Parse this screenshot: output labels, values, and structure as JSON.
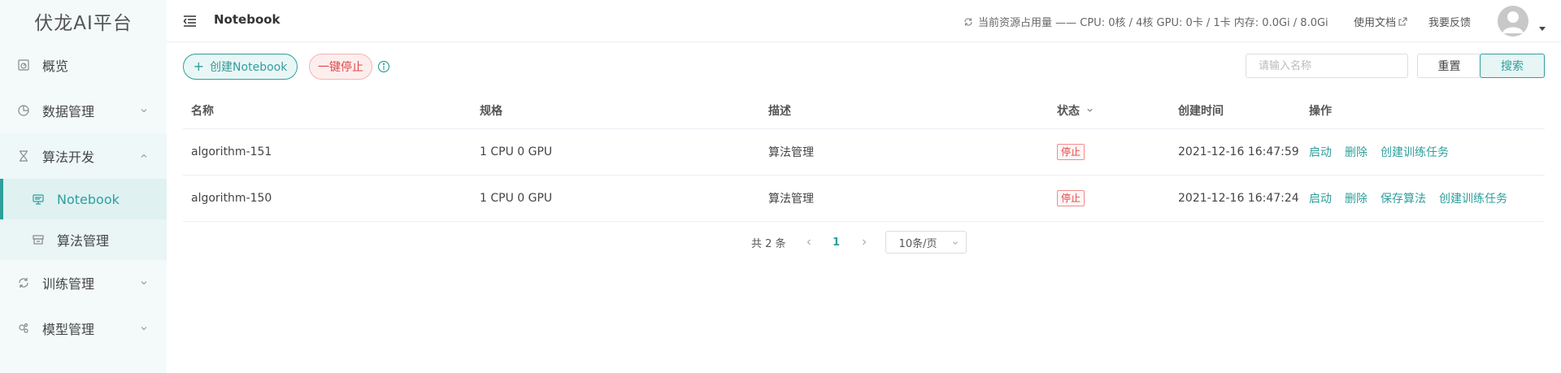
{
  "app": {
    "title": "伏龙AI平台"
  },
  "sidebar": {
    "items": [
      {
        "label": "概览",
        "icon": "dashboard-icon"
      },
      {
        "label": "数据管理",
        "icon": "pie-chart-icon"
      },
      {
        "label": "算法开发",
        "icon": "hourglass-icon"
      },
      {
        "label": "Notebook",
        "icon": "monitor-icon",
        "active": true
      },
      {
        "label": "算法管理",
        "icon": "archive-icon"
      },
      {
        "label": "训练管理",
        "icon": "cycle-icon"
      },
      {
        "label": "模型管理",
        "icon": "cog-cluster-icon"
      }
    ]
  },
  "header": {
    "title": "Notebook",
    "resource": "当前资源占用量 —— CPU: 0核 / 4核 GPU: 0卡 / 1卡 内存: 0.0Gi / 8.0Gi",
    "docs": "使用文档",
    "feedback": "我要反馈"
  },
  "toolbar": {
    "create_label": "创建Notebook",
    "stop_label": "一键停止",
    "search_placeholder": "请输入名称",
    "reset_label": "重置",
    "search_label": "搜索"
  },
  "table": {
    "columns": [
      "名称",
      "规格",
      "描述",
      "状态",
      "创建时间",
      "操作"
    ],
    "rows": [
      {
        "name": "algorithm-151",
        "spec": "1 CPU 0 GPU",
        "desc": "算法管理",
        "status": "停止",
        "created": "2021-12-16 16:47:59",
        "actions": [
          "启动",
          "删除",
          "创建训练任务"
        ]
      },
      {
        "name": "algorithm-150",
        "spec": "1 CPU 0 GPU",
        "desc": "算法管理",
        "status": "停止",
        "created": "2021-12-16 16:47:24",
        "actions": [
          "启动",
          "删除",
          "保存算法",
          "创建训练任务"
        ]
      }
    ]
  },
  "pagination": {
    "total": "共 2 条",
    "current_page": "1",
    "page_size": "10条/页"
  },
  "colors": {
    "accent": "#2e9f9b",
    "danger": "#e04848",
    "sidebar_bg": "#f4fafa"
  }
}
